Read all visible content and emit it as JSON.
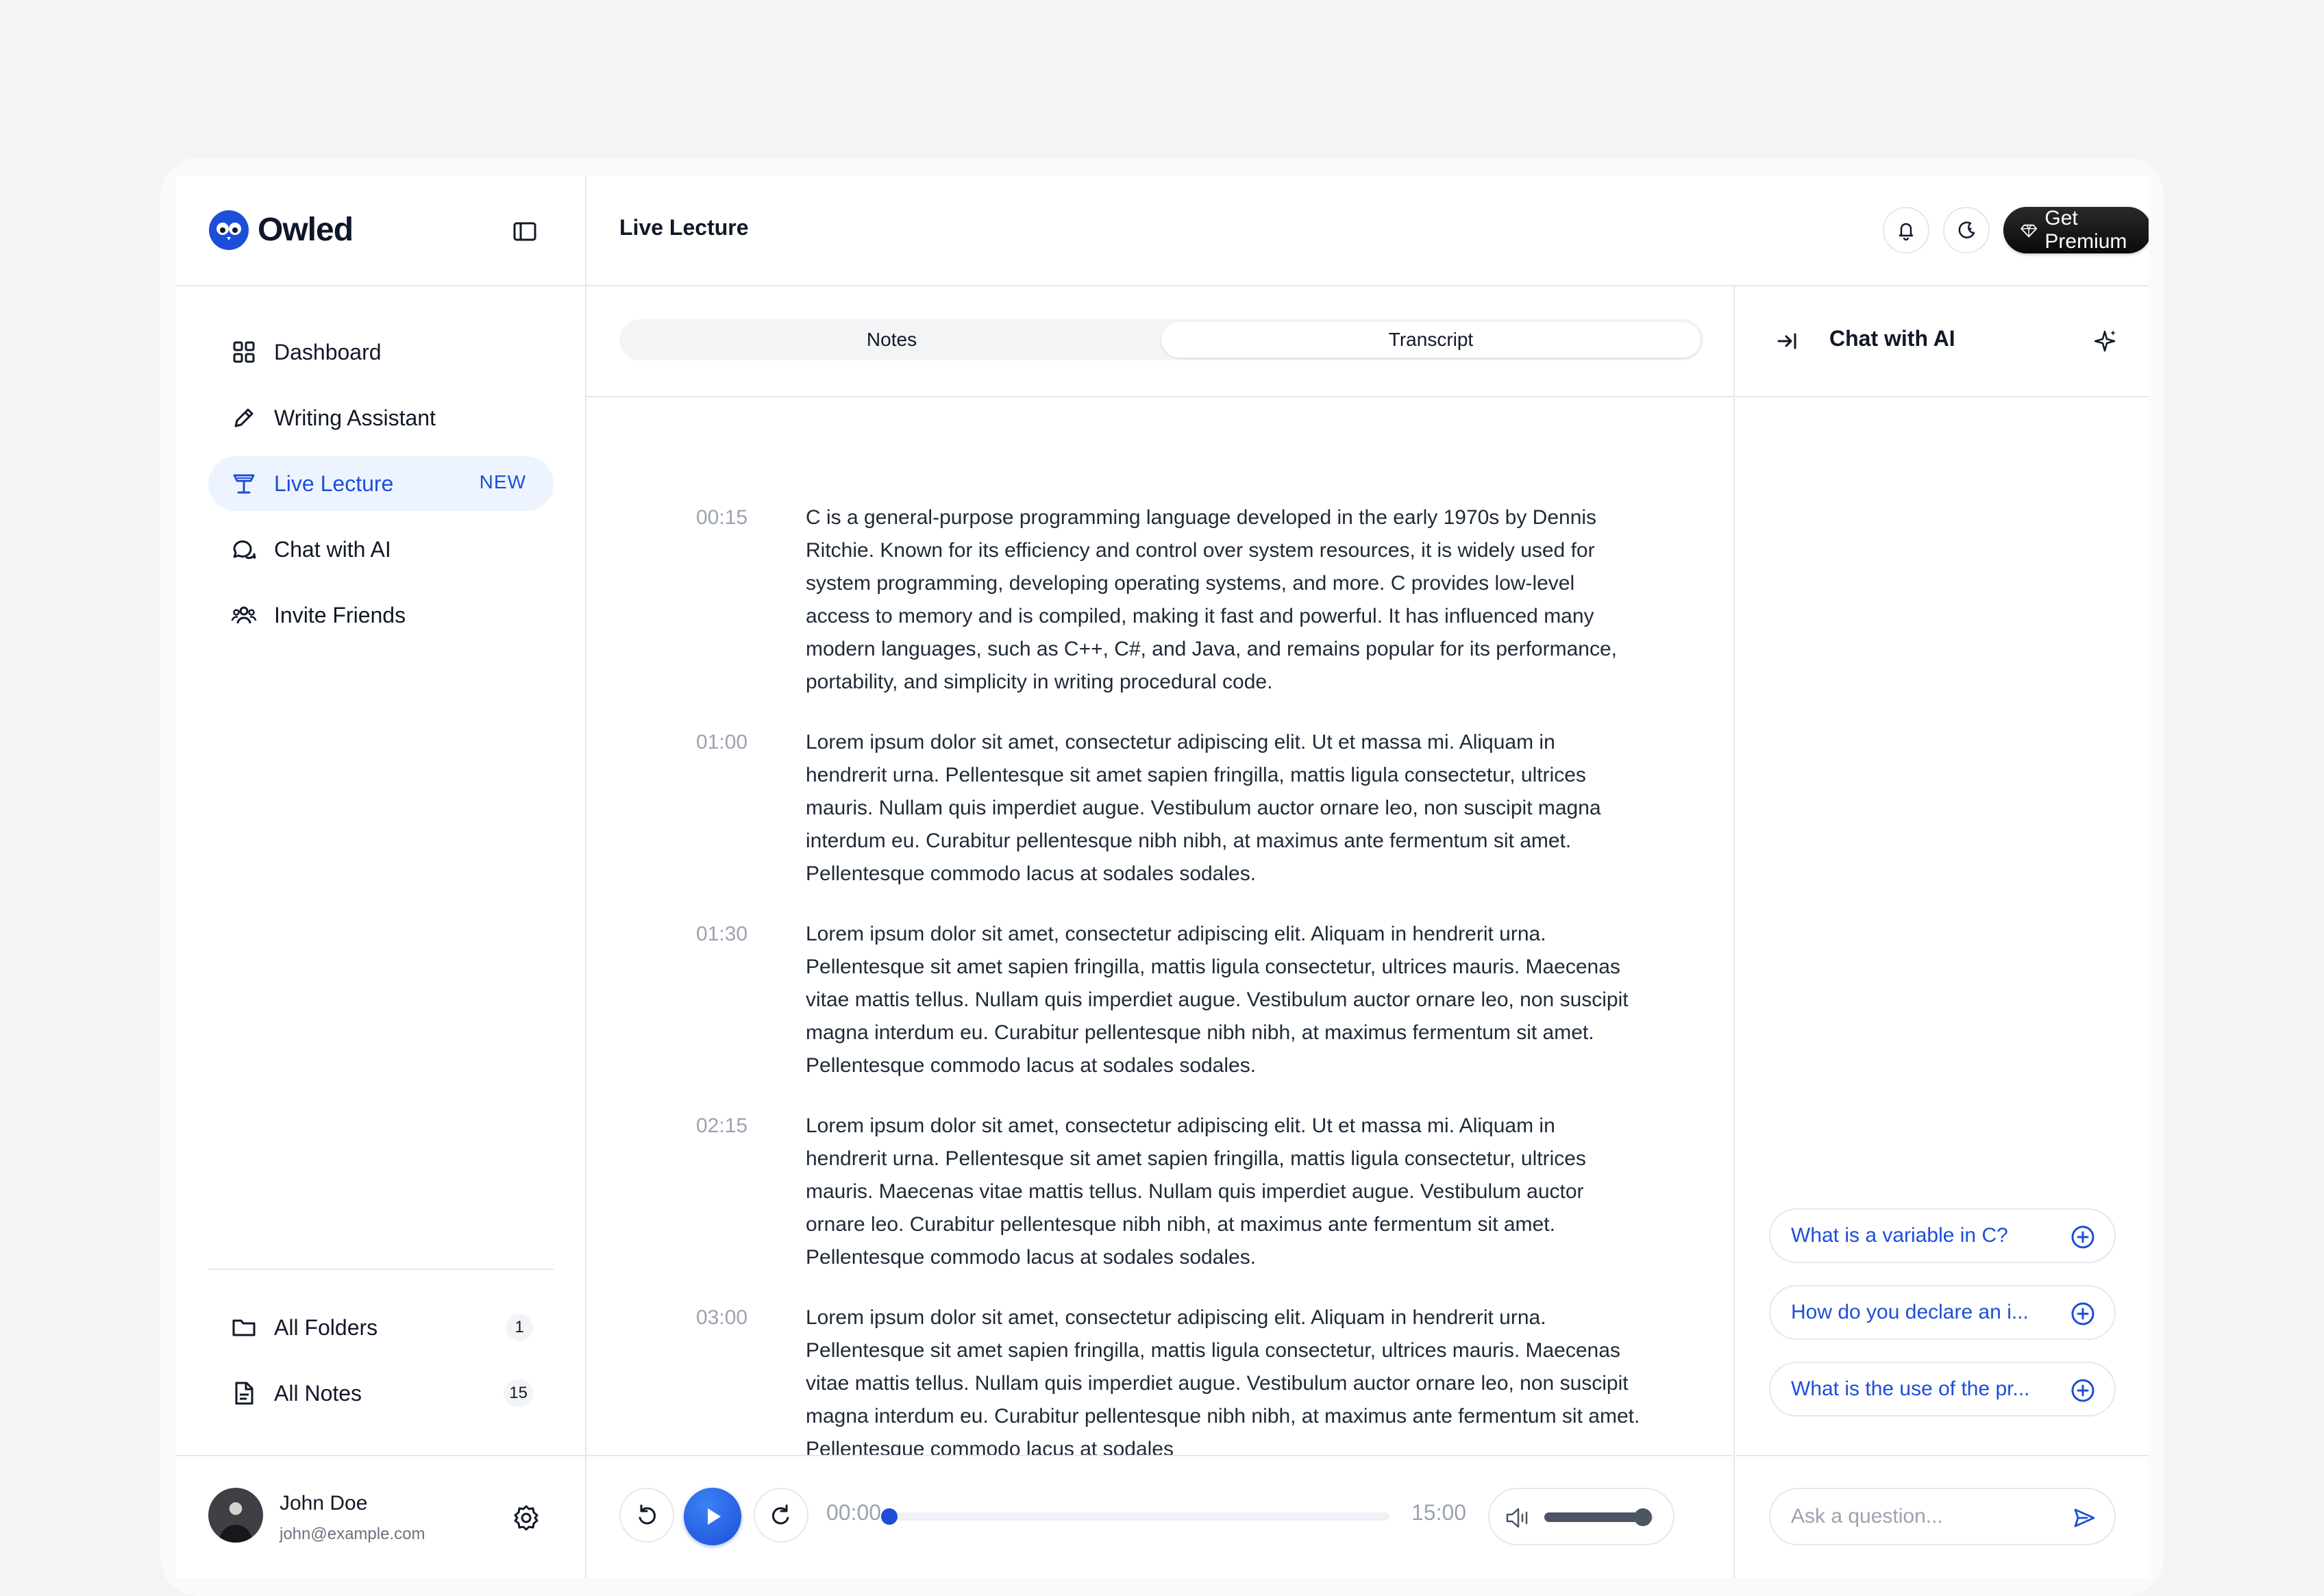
{
  "app": {
    "name": "Owled"
  },
  "sidebar": {
    "items": [
      {
        "label": "Dashboard",
        "icon": "dashboard-icon"
      },
      {
        "label": "Writing Assistant",
        "icon": "pencil-icon"
      },
      {
        "label": "Live Lecture",
        "icon": "lectern-icon",
        "badge": "NEW",
        "active": true
      },
      {
        "label": "Chat with AI",
        "icon": "chat-bubbles-icon"
      },
      {
        "label": "Invite Friends",
        "icon": "users-icon"
      }
    ],
    "folders": [
      {
        "label": "All Folders",
        "count": "1",
        "icon": "folder-icon"
      },
      {
        "label": "All Notes",
        "count": "15",
        "icon": "document-icon"
      }
    ],
    "user": {
      "name": "John Doe",
      "email": "john@example.com"
    }
  },
  "header": {
    "title": "Live Lecture",
    "premium_label": "Get Premium"
  },
  "main": {
    "tabs": [
      {
        "label": "Notes",
        "active": false
      },
      {
        "label": "Transcript",
        "active": true
      }
    ],
    "transcript": [
      {
        "time": "00:15",
        "text": "C is a general-purpose programming language developed in the early 1970s by Dennis Ritchie. Known for its efficiency and control over system resources, it is widely used for system programming, developing operating systems, and more. C provides low-level access to memory and is compiled, making it fast and powerful. It has influenced many modern languages, such as C++, C#, and Java, and remains popular for its performance, portability, and simplicity in writing procedural code."
      },
      {
        "time": "01:00",
        "text": "Lorem ipsum dolor sit amet, consectetur adipiscing elit. Ut et massa mi. Aliquam in hendrerit urna. Pellentesque sit amet sapien fringilla, mattis ligula consectetur, ultrices mauris. Nullam quis imperdiet augue. Vestibulum auctor ornare leo, non suscipit magna interdum eu. Curabitur pellentesque nibh nibh, at maximus ante fermentum sit amet. Pellentesque commodo lacus at sodales sodales."
      },
      {
        "time": "01:30",
        "text": "Lorem ipsum dolor sit amet, consectetur adipiscing elit. Aliquam in hendrerit urna. Pellentesque sit amet sapien fringilla, mattis ligula consectetur, ultrices mauris. Maecenas vitae mattis tellus. Nullam quis imperdiet augue. Vestibulum auctor ornare leo, non suscipit magna interdum eu. Curabitur pellentesque nibh nibh, at maximus fermentum sit amet. Pellentesque commodo lacus at sodales sodales."
      },
      {
        "time": "02:15",
        "text": "Lorem ipsum dolor sit amet, consectetur adipiscing elit. Ut et massa mi. Aliquam in hendrerit urna. Pellentesque sit amet sapien fringilla, mattis ligula consectetur, ultrices mauris. Maecenas vitae mattis tellus. Nullam quis imperdiet augue. Vestibulum auctor ornare leo. Curabitur pellentesque nibh nibh, at maximus ante fermentum sit amet. Pellentesque commodo lacus at sodales sodales."
      },
      {
        "time": "03:00",
        "text": "Lorem ipsum dolor sit amet, consectetur adipiscing elit. Aliquam in hendrerit urna. Pellentesque sit amet sapien fringilla, mattis ligula consectetur, ultrices mauris. Maecenas vitae mattis tellus. Nullam quis imperdiet augue. Vestibulum auctor ornare leo, non suscipit magna interdum eu. Curabitur pellentesque nibh nibh, at maximus ante fermentum sit amet. Pellentesque commodo lacus at sodales"
      }
    ]
  },
  "chat": {
    "title": "Chat with AI",
    "suggestions": [
      "What is a variable in C?",
      "How do you declare an i...",
      "What is the use of the pr..."
    ],
    "input_placeholder": "Ask a question..."
  },
  "player": {
    "current_time": "00:00",
    "total_time": "15:00",
    "progress": 0,
    "volume": 0.9
  },
  "colors": {
    "accent": "#1d4ed8",
    "active_bg": "#eef4ff",
    "border": "#e5e7eb",
    "muted_text": "#9ca3af"
  }
}
